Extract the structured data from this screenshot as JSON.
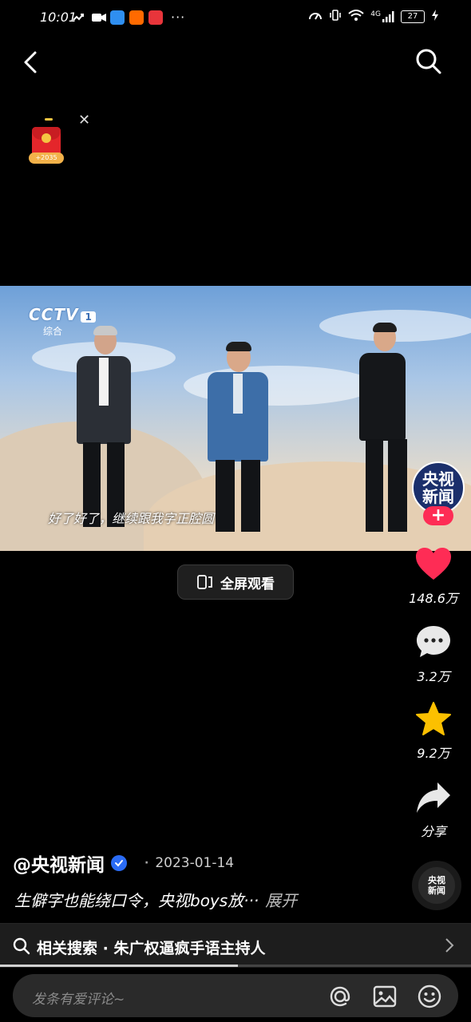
{
  "status_bar": {
    "time": "10:01",
    "network": "4G",
    "battery": "27",
    "more": "···"
  },
  "red_packet": {
    "amount": "+2035"
  },
  "video": {
    "channel_logo": "CCTV",
    "channel_number": "1",
    "channel_sub": "综合",
    "subtitle": "好了好了，继续跟我字正腔圆",
    "channel_badge_line1": "央视",
    "channel_badge_line2": "新闻"
  },
  "fullscreen_label": "全屏观看",
  "actions": {
    "likes": "148.6万",
    "comments": "3.2万",
    "favorites": "9.2万",
    "share": "分享"
  },
  "post": {
    "author": "@央视新闻",
    "separator": "·",
    "date": "2023-01-14",
    "description": "生僻字也能绕口令，央视boys放···",
    "expand": "展开"
  },
  "music_disc": {
    "line1": "央视",
    "line2": "新闻"
  },
  "related_search": {
    "text": "相关搜索 · 朱广权逼疯手语主持人"
  },
  "playback": {
    "progress": 0.505
  },
  "comment_input": {
    "placeholder": "发条有爱评论~"
  },
  "colors": {
    "like": "#fe2c55",
    "star": "#fcc000",
    "verified": "#2b6cf5"
  }
}
